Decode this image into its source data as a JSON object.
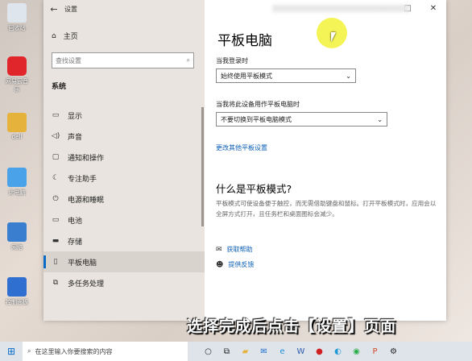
{
  "desktop": {
    "icons": [
      {
        "label": "回收站",
        "color": "#dfe5ec"
      },
      {
        "label": "网易云音乐",
        "color": "#e0262a"
      },
      {
        "label": "dell",
        "color": "#e5b33c"
      },
      {
        "label": "此电脑",
        "color": "#4aa3e8"
      },
      {
        "label": "网络",
        "color": "#3a7fcf"
      },
      {
        "label": "控制面板",
        "color": "#2f6fcf"
      }
    ]
  },
  "window": {
    "title": "设置",
    "back_icon": "back-arrow-icon",
    "home_label": "主页",
    "search_placeholder": "查找设置",
    "section_label": "系统",
    "nav": [
      {
        "label": "显示",
        "icon": "display-icon"
      },
      {
        "label": "声音",
        "icon": "sound-icon"
      },
      {
        "label": "通知和操作",
        "icon": "notification-icon"
      },
      {
        "label": "专注助手",
        "icon": "moon-icon"
      },
      {
        "label": "电源和睡眠",
        "icon": "power-icon"
      },
      {
        "label": "电池",
        "icon": "battery-icon"
      },
      {
        "label": "存储",
        "icon": "storage-icon"
      },
      {
        "label": "平板电脑",
        "icon": "tablet-icon"
      },
      {
        "label": "多任务处理",
        "icon": "multitask-icon"
      }
    ],
    "active_nav": "平板电脑",
    "controls": {
      "minimize": "—",
      "maximize": "□",
      "close": "✕"
    }
  },
  "main": {
    "heading": "平板电脑",
    "signin_label": "当我登录时",
    "signin_value": "始终使用平板模式",
    "device_label": "当我将此设备用作平板电脑时",
    "device_value": "不要切换到平板电脑模式",
    "more_link": "更改其他平板设置",
    "what_heading": "什么是平板模式?",
    "what_desc": "平板模式可使设备便于触控，而无需借助键盘和鼠标。打开平板模式时，应用会以全屏方式打开，且任务栏和桌面图标会减少。",
    "help_label": "获取帮助",
    "feedback_label": "提供反馈"
  },
  "caption": "选择完成后点击【设置】页面",
  "taskbar": {
    "search_placeholder": "在这里输入你要搜索的内容",
    "accent": "#0a6cc7"
  }
}
